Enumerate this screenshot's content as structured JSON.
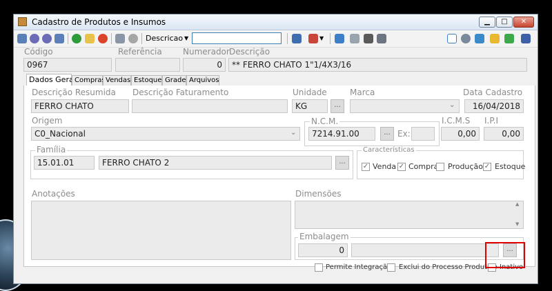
{
  "window": {
    "title": "Cadastro de Produtos e Insumos"
  },
  "title_buttons": {
    "minimize": "▁",
    "maximize": "□",
    "close": "✕"
  },
  "toolbar": {
    "combo_label": "Descricao",
    "search_value": "",
    "icons": [
      "first-icon",
      "prev-icon",
      "next-icon",
      "last-icon",
      "add-icon",
      "edit-icon",
      "delete-icon",
      "save-icon",
      "undo-icon",
      "export-icon",
      "chart-icon",
      "list-icon",
      "grid-icon",
      "barcode-icon",
      "filter-icon",
      "report-icon",
      "settings-icon",
      "refresh-icon",
      "tag-icon",
      "tree-icon",
      "exit-icon"
    ]
  },
  "header": {
    "codigo_label": "Código",
    "codigo_value": "0967",
    "referencia_label": "Referência",
    "referencia_value": "",
    "numerador_label": "Numerador",
    "numerador_value": "0",
    "descricao_label": "Descrição",
    "descricao_value": "** FERRO CHATO 1\"1/4X3/16"
  },
  "tabs": [
    {
      "label": "Dados Gerais"
    },
    {
      "label": "Compras"
    },
    {
      "label": "Vendas"
    },
    {
      "label": "Estoque"
    },
    {
      "label": "Grade"
    },
    {
      "label": "Arquivos"
    }
  ],
  "general": {
    "descricao_resumida_label": "Descrição Resumida",
    "descricao_resumida_value": "FERRO CHATO",
    "descricao_faturamento_label": "Descrição Faturamento",
    "descricao_faturamento_value": "",
    "unidade_label": "Unidade",
    "unidade_value": "KG",
    "marca_label": "Marca",
    "marca_value": "",
    "data_cadastro_label": "Data Cadastro",
    "data_cadastro_value": "16/04/2018",
    "origem_label": "Origem",
    "origem_value": "C0_Nacional",
    "ncm_label": "N.C.M.",
    "ncm_value": "7214.91.00",
    "ex_label": "Ex:",
    "ex_value": "",
    "icms_label": "I.C.M.S",
    "icms_value": "0,00",
    "ipi_label": "I.P.I",
    "ipi_value": "0,00",
    "familia_label": "Família",
    "familia_code": "15.01.01",
    "familia_name": "FERRO CHATO 2",
    "caracteristicas_label": "Características",
    "caracteristicas": [
      {
        "label": "Venda",
        "checked": true
      },
      {
        "label": "Compra",
        "checked": true
      },
      {
        "label": "Produção",
        "checked": false
      },
      {
        "label": "Estoque",
        "checked": true
      }
    ],
    "anotacoes_label": "Anotações",
    "dimensoes_label": "Dimensões",
    "embalagem_label": "Embalagem",
    "embalagem_qty": "0",
    "embalagem_desc": "",
    "lookup_button": "...",
    "options": [
      {
        "label": "Permite Integração",
        "checked": false
      },
      {
        "label": "Exclui do Processo Produtivo",
        "checked": false
      },
      {
        "label": "Inativo",
        "checked": false
      }
    ]
  },
  "colors": {
    "highlight": "#e00000",
    "title_bar": "#dbe6f3",
    "field_bg": "#ebebeb"
  }
}
